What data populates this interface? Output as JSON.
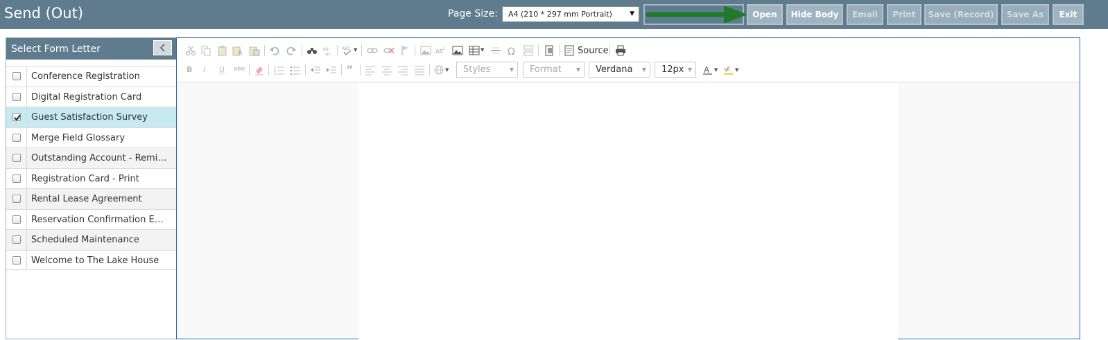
{
  "header": {
    "title": "Send (Out)",
    "page_size_label": "Page Size:",
    "page_size_value": "A4 (210 * 297 mm Portrait)",
    "buttons": {
      "open": "Open",
      "hide_body": "Hide Body",
      "email": "Email",
      "print": "Print",
      "save_record": "Save (Record)",
      "save_as": "Save As",
      "exit": "Exit"
    }
  },
  "left_panel": {
    "title": "Select Form Letter",
    "items": [
      {
        "label": "Conference Registration",
        "checked": false
      },
      {
        "label": "Digital Registration Card",
        "checked": false
      },
      {
        "label": "Guest Satisfaction Survey",
        "checked": true
      },
      {
        "label": "Merge Field Glossary",
        "checked": false
      },
      {
        "label": "Outstanding Account - Reminder",
        "checked": false
      },
      {
        "label": "Registration Card - Print",
        "checked": false
      },
      {
        "label": "Rental Lease Agreement",
        "checked": false
      },
      {
        "label": "Reservation Confirmation Email",
        "checked": false
      },
      {
        "label": "Scheduled Maintenance",
        "checked": false
      },
      {
        "label": "Welcome to The Lake House",
        "checked": false
      }
    ]
  },
  "editor": {
    "source_label": "Source",
    "styles_placeholder": "Styles",
    "format_placeholder": "Format",
    "font_family": "Verdana",
    "font_size": "12px"
  },
  "colors": {
    "header_bg": "#5f7c8e",
    "selected_row": "#c7eaf1",
    "arrow": "#1e7a2a",
    "editor_border": "#2a66a6"
  }
}
